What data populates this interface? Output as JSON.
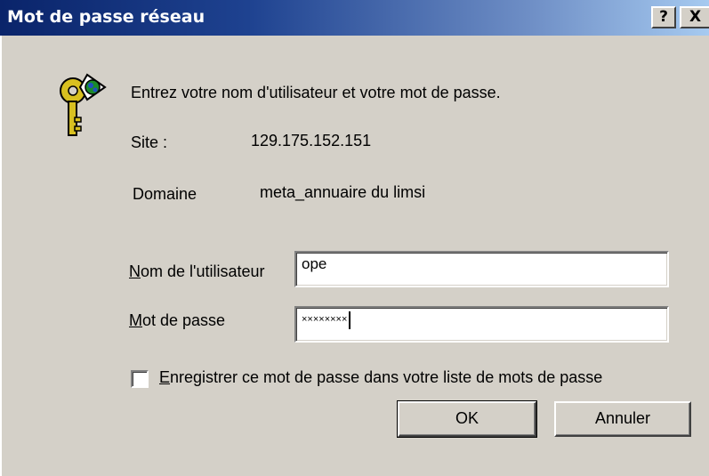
{
  "window": {
    "title": "Mot de passe réseau",
    "help_label": "?",
    "close_label": "X"
  },
  "prompt": "Entrez votre nom d'utilisateur et votre mot de passe.",
  "site": {
    "label": "Site :",
    "value": "129.175.152.151"
  },
  "domain": {
    "label": "Domaine",
    "value": "meta_annuaire du limsi"
  },
  "username": {
    "label_mnemonic": "N",
    "label_rest": "om de l'utilisateur",
    "value": "ope"
  },
  "password": {
    "label_mnemonic": "M",
    "label_rest": "ot de passe",
    "mask": "××××××××"
  },
  "save_password": {
    "label_mnemonic": "E",
    "label_rest": "nregistrer ce mot de passe dans votre liste de mots de passe",
    "checked": false
  },
  "buttons": {
    "ok": "OK",
    "cancel": "Annuler"
  },
  "icon": "keys-icon"
}
